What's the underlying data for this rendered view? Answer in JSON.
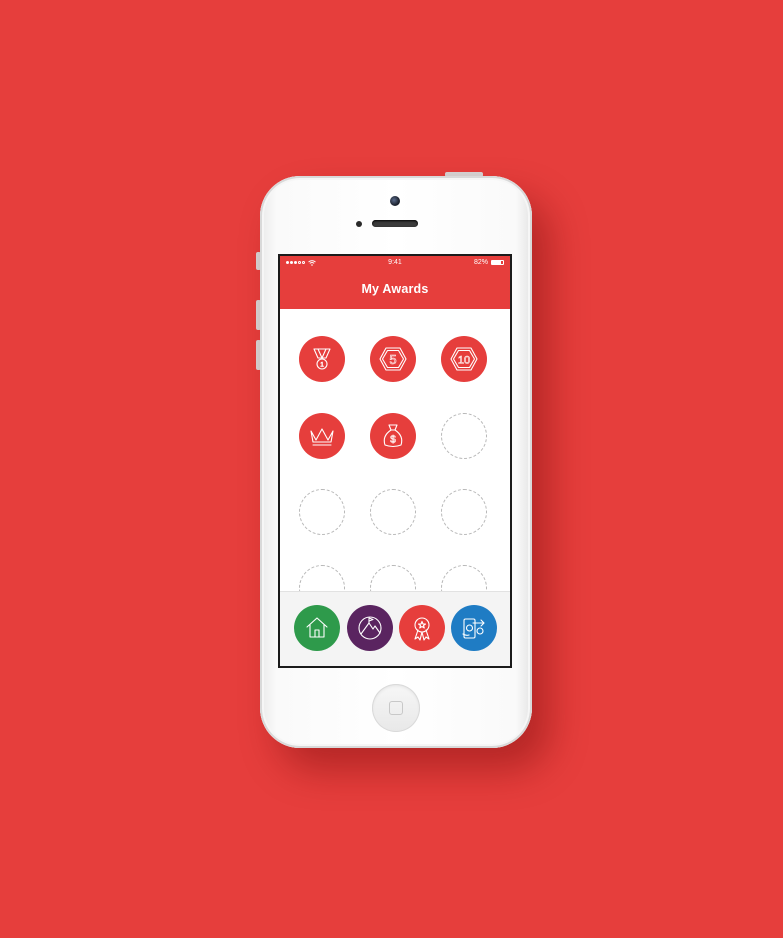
{
  "status_bar": {
    "time": "9:41",
    "battery_text": "82%",
    "battery_level": 0.82,
    "signal_dots": 5,
    "signal_filled": 3,
    "wifi_icon": "wifi-icon"
  },
  "header": {
    "title": "My Awards"
  },
  "awards": [
    {
      "icon": "medal-icon",
      "earned": true,
      "badge_text": "1"
    },
    {
      "icon": "hexagon-5-icon",
      "earned": true,
      "badge_text": "5"
    },
    {
      "icon": "hexagon-10-icon",
      "earned": true,
      "badge_text": "10"
    },
    {
      "icon": "crown-icon",
      "earned": true,
      "badge_text": ""
    },
    {
      "icon": "money-bag-icon",
      "earned": true,
      "badge_text": "$"
    },
    {
      "icon": "empty-slot",
      "earned": false,
      "badge_text": ""
    },
    {
      "icon": "empty-slot",
      "earned": false,
      "badge_text": ""
    },
    {
      "icon": "empty-slot",
      "earned": false,
      "badge_text": ""
    },
    {
      "icon": "empty-slot",
      "earned": false,
      "badge_text": ""
    },
    {
      "icon": "empty-slot",
      "earned": false,
      "badge_text": ""
    },
    {
      "icon": "empty-slot",
      "earned": false,
      "badge_text": ""
    },
    {
      "icon": "empty-slot",
      "earned": false,
      "badge_text": ""
    }
  ],
  "tabs": [
    {
      "name": "home",
      "icon": "home-icon",
      "color": "#2e9a4b"
    },
    {
      "name": "goals",
      "icon": "mountain-icon",
      "color": "#5a2460"
    },
    {
      "name": "awards",
      "icon": "award-ribbon-icon",
      "color": "#e63e3c"
    },
    {
      "name": "transfer",
      "icon": "phone-transfer-icon",
      "color": "#1f7cc4"
    }
  ],
  "colors": {
    "background": "#e63e3c",
    "accent": "#e63e3c",
    "home": "#2e9a4b",
    "goals": "#5a2460",
    "transfer": "#1f7cc4"
  }
}
